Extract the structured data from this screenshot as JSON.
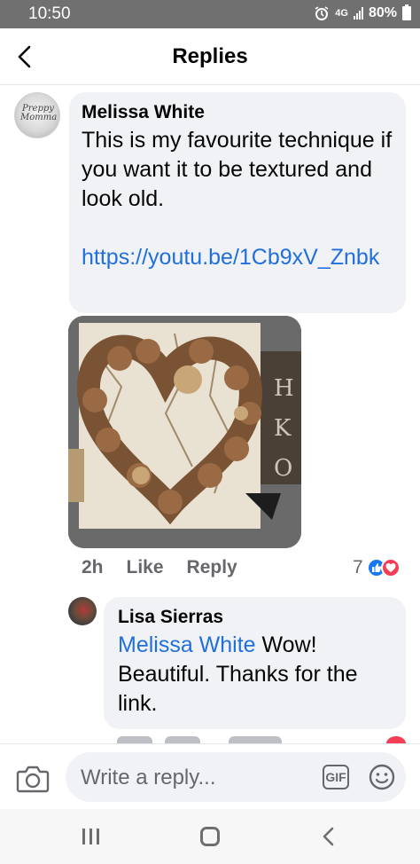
{
  "status_bar": {
    "time": "10:50",
    "network": "4G",
    "battery": "80%"
  },
  "header": {
    "title": "Replies",
    "back_icon": "chevron-left-icon"
  },
  "comment": {
    "author": "Melissa White",
    "avatar_text": "Preppy Momma",
    "text": "This is my favourite technique if you want it to be textured and look old.",
    "link": "https://youtu.be/1Cb9xV_Znbk",
    "photo": "pinecone-heart-photo",
    "actions": {
      "time": "2h",
      "like": "Like",
      "reply": "Reply"
    },
    "reaction_count": "7",
    "reaction_icons": [
      "like-icon",
      "love-icon"
    ]
  },
  "reply": {
    "author": "Lisa Sierras",
    "mention": "Melissa White",
    "text": " Wow! Beautiful. Thanks for the link."
  },
  "composer": {
    "placeholder": "Write a reply...",
    "gif_label": "GIF"
  },
  "colors": {
    "link": "#216fdb",
    "bubble": "#f0f2f5",
    "like": "#1877f2",
    "love": "#f33e58"
  }
}
